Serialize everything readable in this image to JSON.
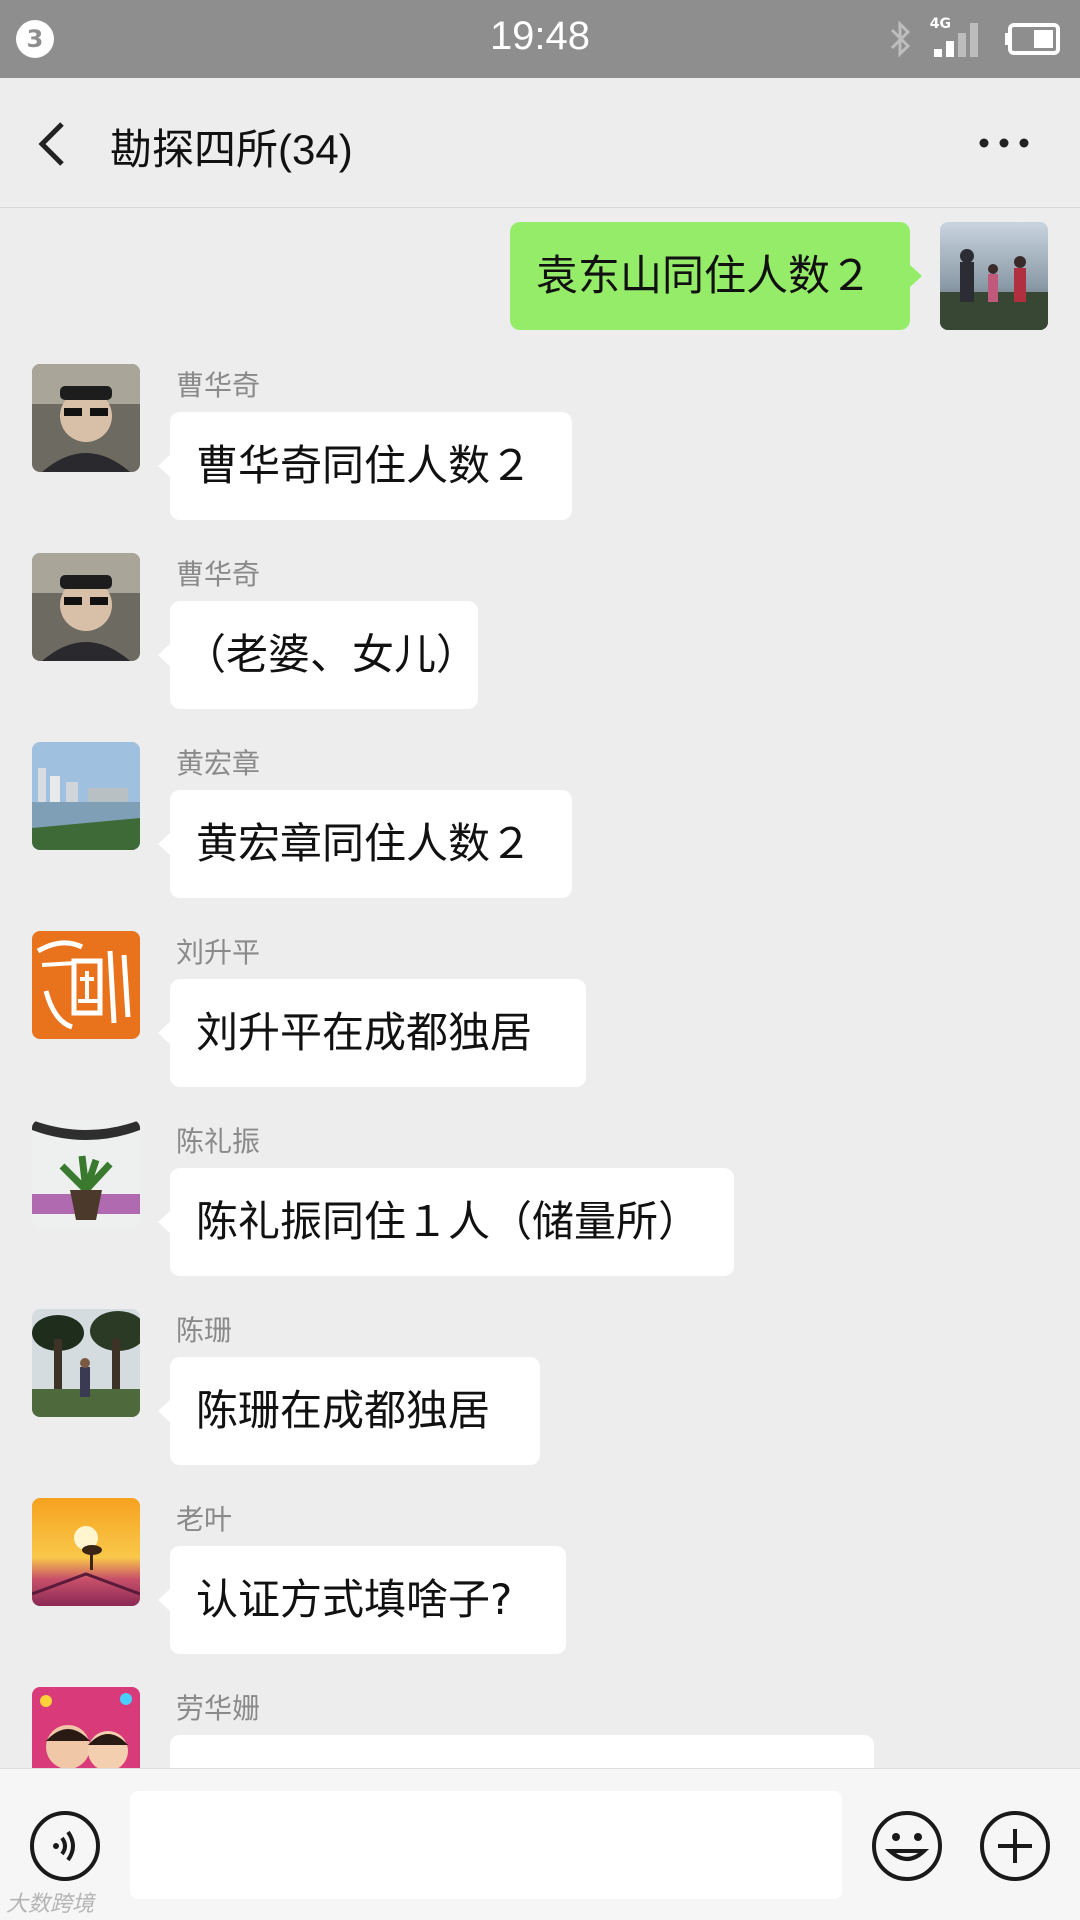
{
  "status_bar": {
    "notification_count": "3",
    "time": "19:48",
    "network": "4G"
  },
  "header": {
    "title": "勘探四所(34)"
  },
  "messages": [
    {
      "direction": "out",
      "text": "袁东山同住人数２"
    },
    {
      "sender": "曹华奇",
      "text": "曹华奇同住人数２"
    },
    {
      "sender": "曹华奇",
      "text": "（老婆、女儿）"
    },
    {
      "sender": "黄宏章",
      "text": "黄宏章同住人数２"
    },
    {
      "sender": "刘升平",
      "text": "刘升平在成都独居"
    },
    {
      "sender": "陈礼振",
      "text": "陈礼振同住１人（储量所）"
    },
    {
      "sender": "陈珊",
      "text": "陈珊在成都独居"
    },
    {
      "sender": "老叶",
      "text": "认证方式填啥子?"
    },
    {
      "sender": "劳华姗",
      "text": ""
    }
  ],
  "avatars": {
    "self": "family-photo-avatar",
    "cao": "man-in-car-avatar",
    "huang": "city-lake-avatar",
    "liu": "seal-logo-avatar",
    "chen_lz": "plant-avatar",
    "chen_s": "park-trees-avatar",
    "laoye": "sunset-field-avatar",
    "lao_hs": "children-photo-avatar"
  },
  "input": {
    "value": ""
  },
  "watermark": "大数跨境",
  "colors": {
    "status_bar": "#8e8e8e",
    "background": "#ededed",
    "outgoing_bubble": "#95ec69",
    "incoming_bubble": "#ffffff"
  }
}
